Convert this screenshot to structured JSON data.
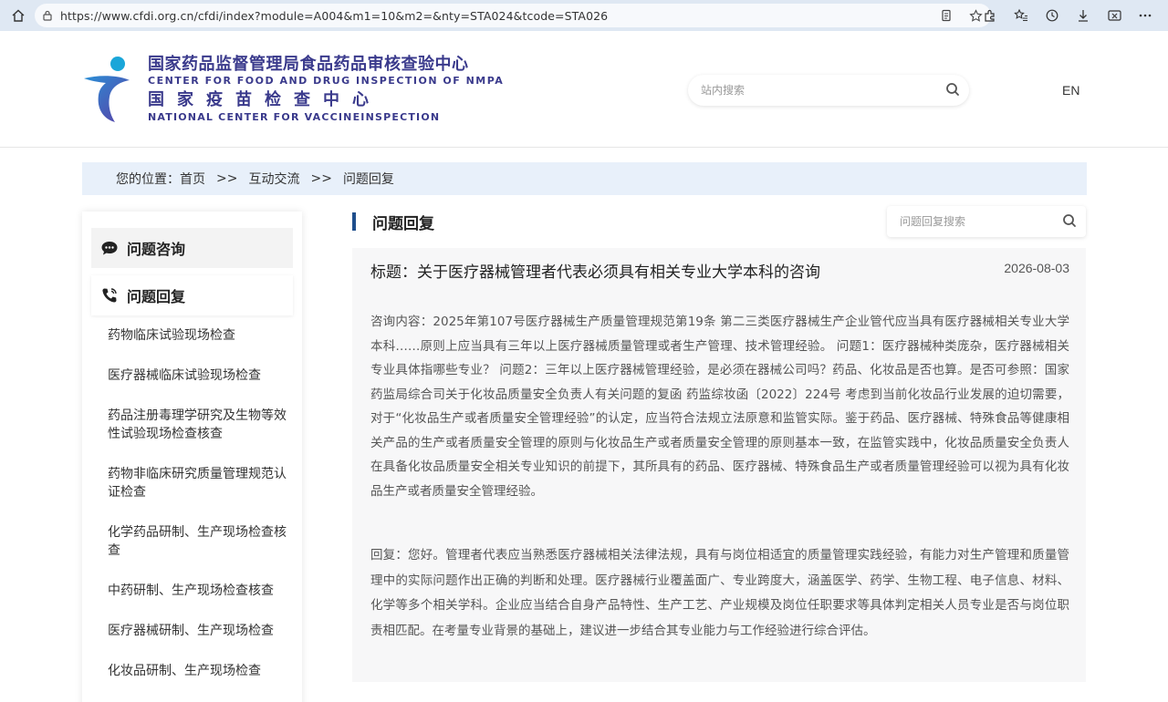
{
  "browser": {
    "url": "https://www.cfdi.org.cn/cfdi/index?module=A004&m1=10&m2=&nty=STA024&tcode=STA026"
  },
  "header": {
    "logo_cn_1": "国家药品监督管理局食品药品审核查验中心",
    "logo_en_1": "CENTER FOR FOOD AND DRUG INSPECTION OF NMPA",
    "logo_cn_2": "国家疫苗检查中心",
    "logo_en_2": "NATIONAL CENTER FOR VACCINEINSPECTION",
    "search_placeholder": "站内搜索",
    "lang": "EN",
    "colors": {
      "brand": "#3a3a8c",
      "logo_blue": "#2a8fd6",
      "logo_purple": "#5a3fa6"
    }
  },
  "breadcrumb": {
    "label": "您的位置：",
    "items": [
      "首页",
      "互动交流",
      "问题回复"
    ],
    "separator": ">>"
  },
  "sidebar": {
    "consult_label": "问题咨询",
    "reply_label": "问题回复",
    "items": [
      "药物临床试验现场检查",
      "医疗器械临床试验现场检查",
      "药品注册毒理学研究及生物等效性试验现场检查核查",
      "药物非临床研究质量管理规范认证检查",
      "化学药品研制、生产现场检查核查",
      "中药研制、生产现场检查核查",
      "医疗器械研制、生产现场检查",
      "化妆品研制、生产现场检查"
    ]
  },
  "main": {
    "title": "问题回复",
    "search_placeholder": "问题回复搜索",
    "accent_color": "#1f4e8c",
    "article": {
      "title": "标题：关于医疗器械管理者代表必须具有相关专业大学本科的咨询",
      "date": "2026-08-03",
      "consult": "咨询内容：2025年第107号医疗器械生产质量管理规范第19条 第二三类医疗器械生产企业管代应当具有医疗器械相关专业大学本科……原则上应当具有三年以上医疗器械质量管理或者生产管理、技术管理经验。 问题1：医疗器械种类庞杂，医疗器械相关专业具体指哪些专业？ 问题2：三年以上医疗器械管理经验，是必须在器械公司吗？药品、化妆品是否也算。是否可参照：国家药监局综合司关于化妆品质量安全负责人有关问题的复函 药监综妆函〔2022〕224号 考虑到当前化妆品行业发展的迫切需要，对于“化妆品生产或者质量安全管理经验”的认定，应当符合法规立法原意和监管实际。鉴于药品、医疗器械、特殊食品等健康相关产品的生产或者质量安全管理的原则与化妆品生产或者质量安全管理的原则基本一致，在监管实践中，化妆品质量安全负责人在具备化妆品质量安全相关专业知识的前提下，其所具有的药品、医疗器械、特殊食品生产或者质量管理经验可以视为具有化妆品生产或者质量安全管理经验。",
      "reply": "回复：您好。管理者代表应当熟悉医疗器械相关法律法规，具有与岗位相适宜的质量管理实践经验，有能力对生产管理和质量管理中的实际问题作出正确的判断和处理。医疗器械行业覆盖面广、专业跨度大，涵盖医学、药学、生物工程、电子信息、材料、化学等多个相关学科。企业应当结合自身产品特性、生产工艺、产业规模及岗位任职要求等具体判定相关人员专业是否与岗位职责相匹配。在考量专业背景的基础上，建议进一步结合其专业能力与工作经验进行综合评估。"
    }
  }
}
